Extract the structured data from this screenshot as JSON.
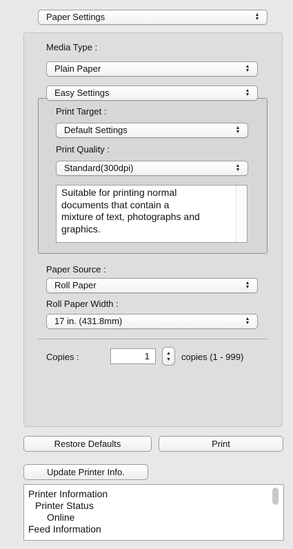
{
  "panel_selector": "Paper Settings",
  "media_type": {
    "label": "Media Type :",
    "value": "Plain Paper"
  },
  "easy_settings": {
    "value": "Easy Settings"
  },
  "print_target": {
    "label": "Print Target :",
    "value": "Default Settings"
  },
  "print_quality": {
    "label": "Print Quality :",
    "value": "Standard(300dpi)"
  },
  "description": "Suitable for printing normal\ndocuments that contain a\nmixture of text, photographs and\ngraphics.",
  "paper_source": {
    "label": "Paper Source :",
    "value": "Roll Paper"
  },
  "roll_paper_width": {
    "label": "Roll Paper Width :",
    "value": "17 in. (431.8mm)"
  },
  "copies": {
    "label": "Copies :",
    "value": "1",
    "range": "copies (1 - 999)"
  },
  "buttons": {
    "restore_defaults": "Restore Defaults",
    "print": "Print",
    "update_printer_info": "Update Printer Info."
  },
  "printer_info": [
    {
      "text": "Printer Information",
      "indent": 0
    },
    {
      "text": "Printer Status",
      "indent": 1
    },
    {
      "text": "Online",
      "indent": 2
    },
    {
      "text": "Feed Information",
      "indent": 0
    }
  ]
}
